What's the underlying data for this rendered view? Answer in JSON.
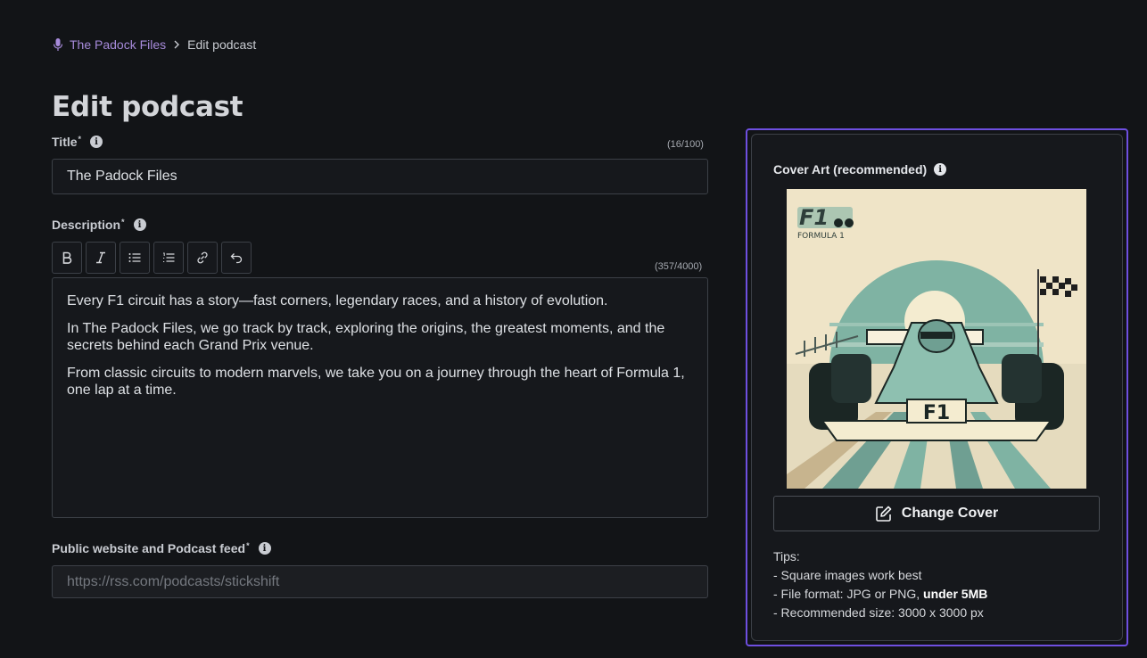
{
  "breadcrumb": {
    "podcast_link": "The Padock Files",
    "current": "Edit podcast"
  },
  "page": {
    "title": "Edit podcast"
  },
  "form": {
    "title": {
      "label": "Title",
      "required_mark": "*",
      "counter": "(16/100)",
      "value": "The Padock Files"
    },
    "description": {
      "label": "Description",
      "required_mark": "*",
      "counter": "(357/4000)",
      "paragraphs": [
        "Every F1 circuit has a story—fast corners, legendary races, and a history of evolution.",
        "In The Padock Files, we go track by track, exploring the origins, the greatest moments, and the secrets behind each Grand Prix venue.",
        "From classic circuits to modern marvels, we take you on a journey through the heart of Formula 1, one lap at a time."
      ],
      "toolbar": [
        "bold-icon",
        "italic-icon",
        "bullet-list-icon",
        "numbered-list-icon",
        "link-icon",
        "undo-icon"
      ]
    },
    "feed": {
      "label": "Public website and Podcast feed",
      "required_mark": "*",
      "placeholder": "https://rss.com/podcasts/stickshift"
    }
  },
  "cover": {
    "label": "Cover Art (recommended)",
    "art_logo_text": "F1",
    "art_logo_subtext": "FORMULA 1",
    "art_car_text": "F1",
    "change_button": "Change Cover",
    "tips_title": "Tips:",
    "tip1": "- Square images work best",
    "tip2_prefix": "- File format: JPG or PNG, ",
    "tip2_bold": "under 5MB",
    "tip3": "- Recommended size: 3000 x 3000 px"
  },
  "colors": {
    "accent": "#6e4fe0",
    "link": "#a78bdb",
    "background": "#121417"
  }
}
